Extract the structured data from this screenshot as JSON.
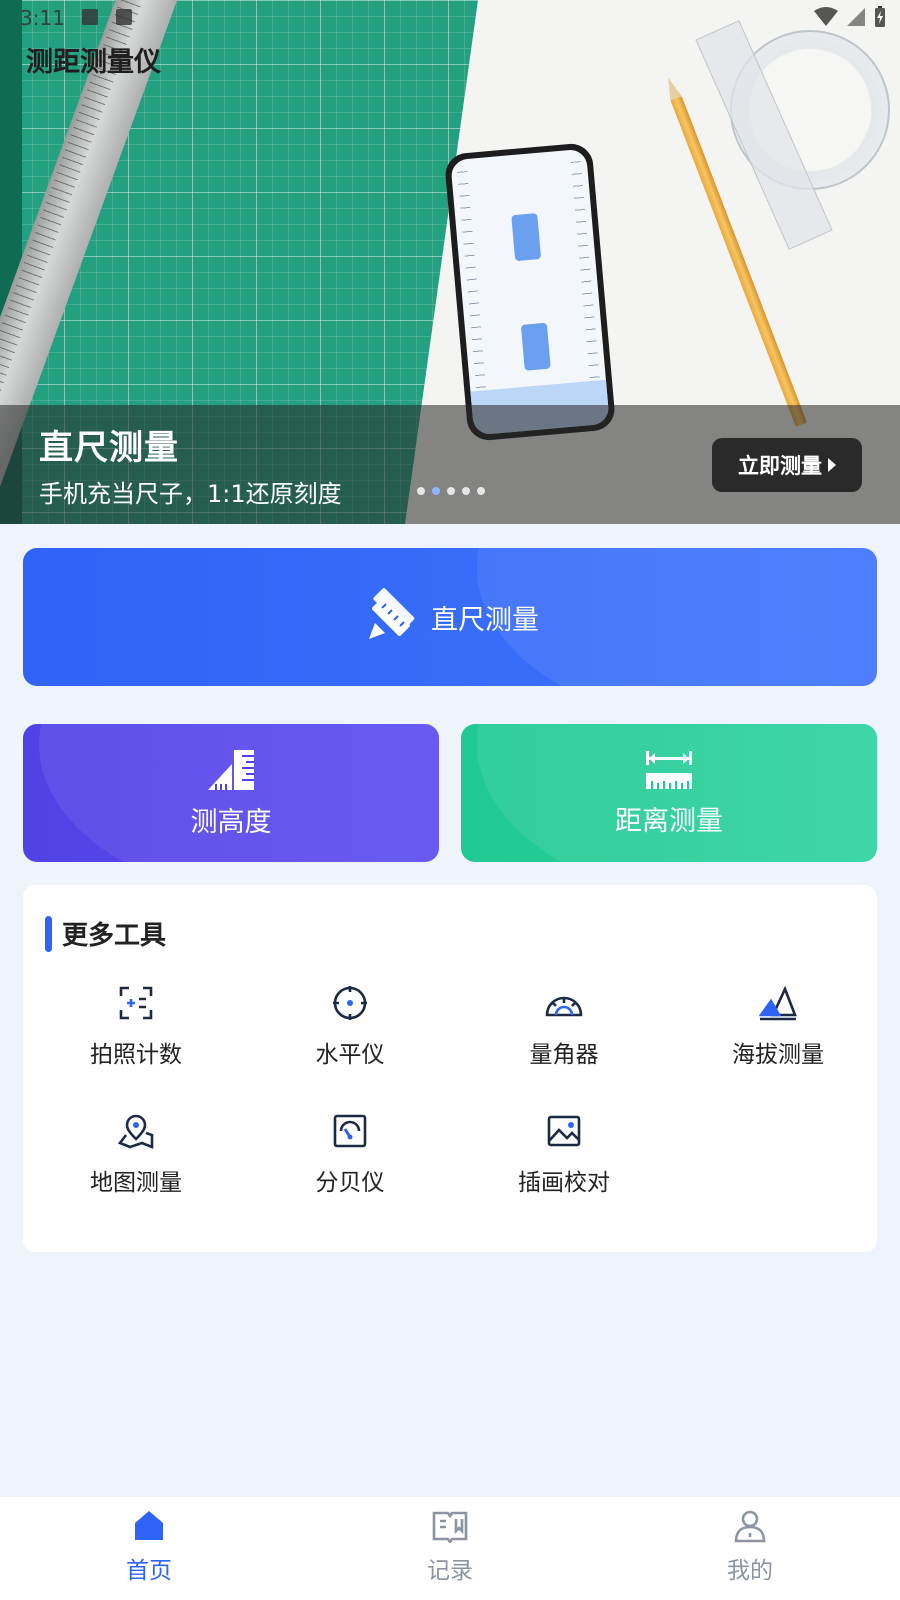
{
  "status_bar": {
    "time": "3:11"
  },
  "app": {
    "title": "测距测量仪"
  },
  "banner": {
    "title": "直尺测量",
    "subtitle": "手机充当尺子，1:1还原刻度",
    "cta_label": "立即测量",
    "slide_count": 5,
    "active_slide": 2
  },
  "main_card": {
    "label": "直尺测量",
    "icon": "ruler-pencil-icon"
  },
  "cards": [
    {
      "label": "测高度",
      "icon": "building-height-icon",
      "color": "#5142e6"
    },
    {
      "label": "距离测量",
      "icon": "distance-icon",
      "color": "#20c992"
    }
  ],
  "more_tools": {
    "heading": "更多工具",
    "items": [
      {
        "label": "拍照计数",
        "icon": "photo-count-icon"
      },
      {
        "label": "水平仪",
        "icon": "level-icon"
      },
      {
        "label": "量角器",
        "icon": "protractor-icon"
      },
      {
        "label": "海拔测量",
        "icon": "altitude-icon"
      },
      {
        "label": "地图测量",
        "icon": "map-pin-icon"
      },
      {
        "label": "分贝仪",
        "icon": "decibel-icon"
      },
      {
        "label": "插画校对",
        "icon": "image-icon"
      }
    ]
  },
  "bottom_nav": [
    {
      "label": "首页",
      "icon": "home-icon",
      "active": true
    },
    {
      "label": "记录",
      "icon": "record-book-icon",
      "active": false
    },
    {
      "label": "我的",
      "icon": "profile-icon",
      "active": false
    }
  ],
  "colors": {
    "accent": "#2f63f6",
    "purple": "#5142e6",
    "green": "#20c992",
    "background": "#eff3fb"
  }
}
